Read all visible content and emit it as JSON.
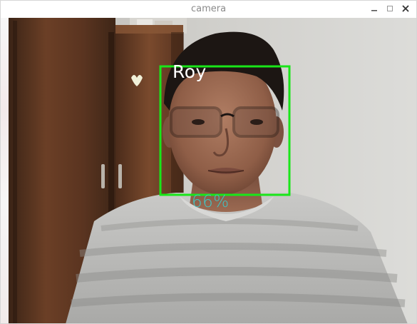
{
  "window": {
    "title": "camera",
    "controls": {
      "minimize_icon": "minimize-icon",
      "maximize_icon": "maximize-icon",
      "close_icon": "close-icon"
    }
  },
  "detection": {
    "name": "Roy",
    "confidence": "66%",
    "box_color": "#19e619",
    "name_color": "#ffffff",
    "confidence_color": "#3fc7c7"
  }
}
